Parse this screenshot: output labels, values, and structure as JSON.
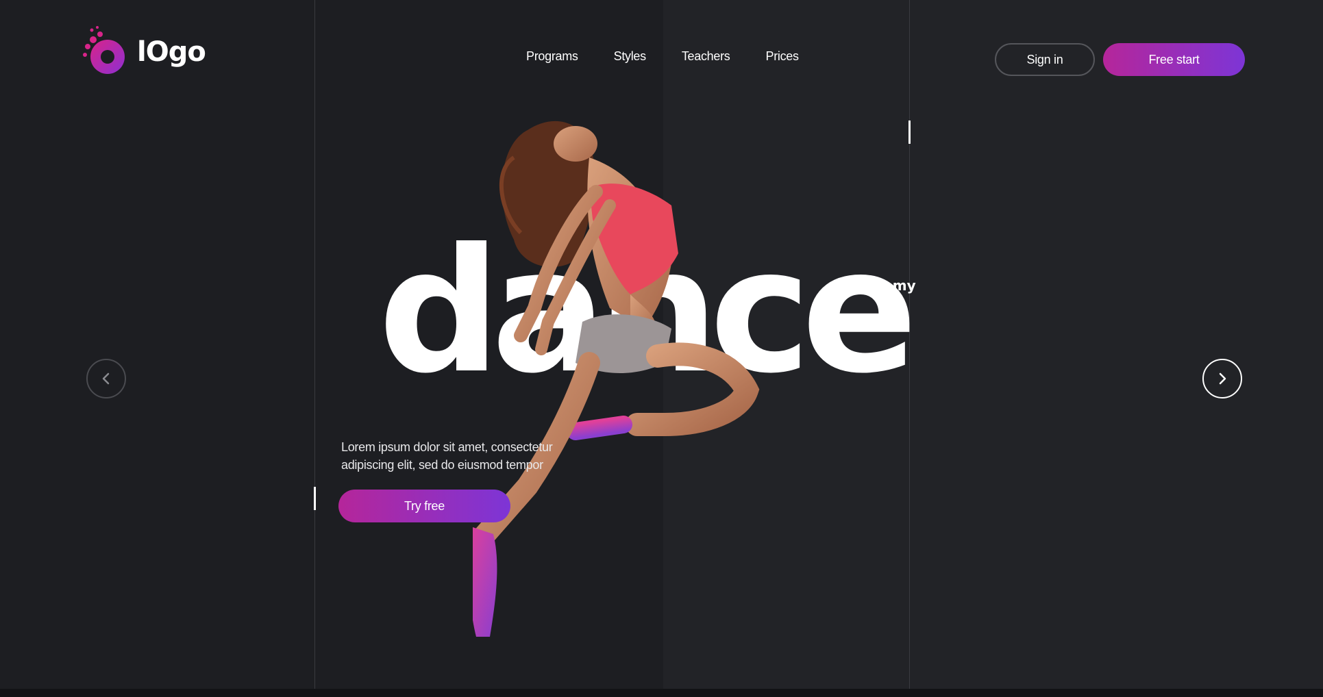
{
  "brand": {
    "logo_text": "lOgo",
    "accent_start": "#b5269a",
    "accent_end": "#7d35d6"
  },
  "nav": {
    "items": [
      {
        "label": "Programs"
      },
      {
        "label": "Styles"
      },
      {
        "label": "Teachers"
      },
      {
        "label": "Prices"
      }
    ]
  },
  "header": {
    "signin_label": "Sign in",
    "free_start_label": "Free start"
  },
  "hero": {
    "title": "dance",
    "subtitle": "academy",
    "description": "Lorem ipsum dolor sit amet, consectetur adipiscing elit, sed do eiusmod tempor",
    "cta_label": "Try free",
    "image": "jumping-dancer"
  },
  "slider": {
    "prev_icon": "chevron-left-icon",
    "next_icon": "chevron-right-icon"
  }
}
